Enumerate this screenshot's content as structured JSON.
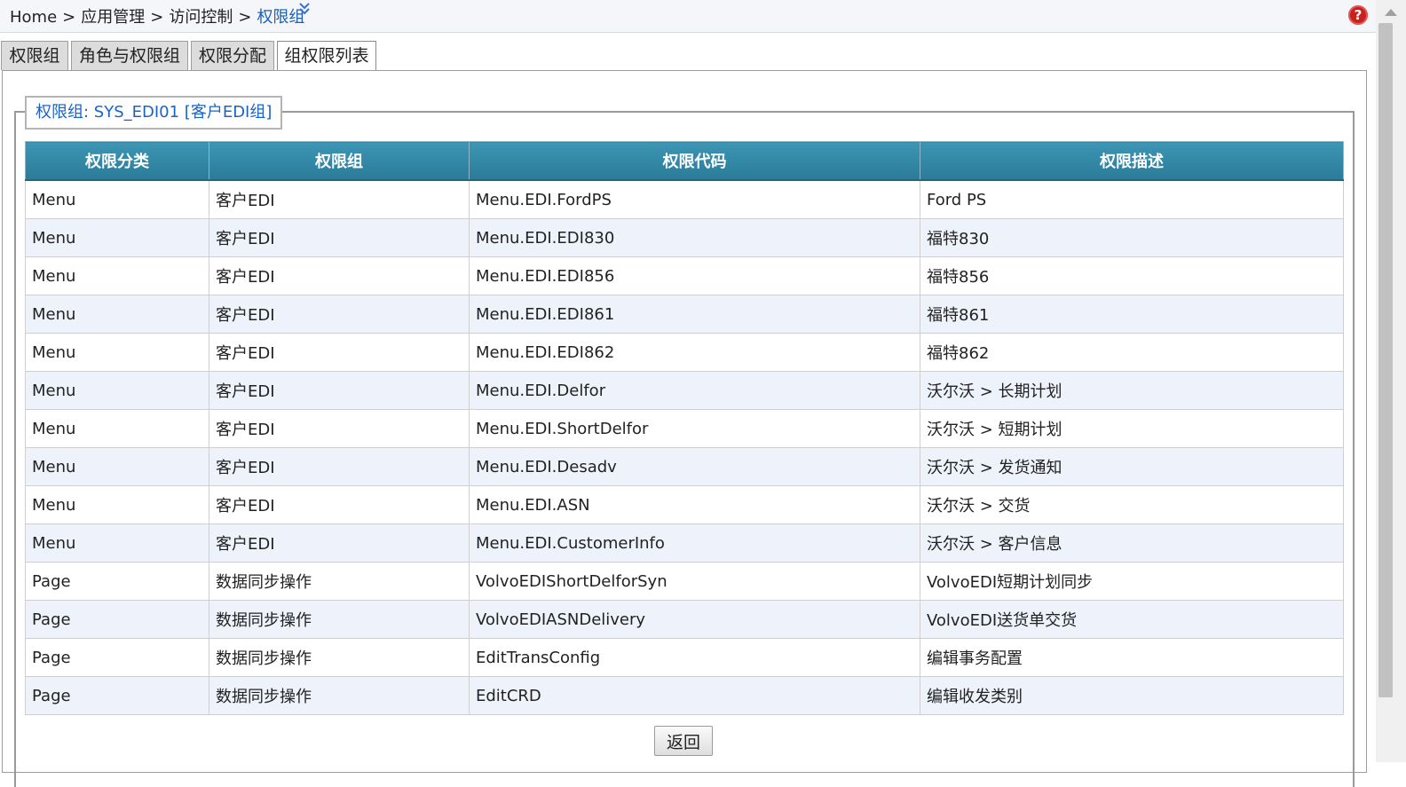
{
  "breadcrumb": {
    "items": [
      "Home",
      "应用管理",
      "访问控制"
    ],
    "current": "权限组",
    "separator": ">"
  },
  "tabs": [
    {
      "label": "权限组",
      "active": false
    },
    {
      "label": "角色与权限组",
      "active": false
    },
    {
      "label": "权限分配",
      "active": false
    },
    {
      "label": "组权限列表",
      "active": true
    }
  ],
  "group_legend": "权限组: SYS_EDI01 [客户EDI组]",
  "table": {
    "headers": [
      "权限分类",
      "权限组",
      "权限代码",
      "权限描述"
    ],
    "rows": [
      [
        "Menu",
        "客户EDI",
        "Menu.EDI.FordPS",
        "Ford PS"
      ],
      [
        "Menu",
        "客户EDI",
        "Menu.EDI.EDI830",
        "福特830"
      ],
      [
        "Menu",
        "客户EDI",
        "Menu.EDI.EDI856",
        "福特856"
      ],
      [
        "Menu",
        "客户EDI",
        "Menu.EDI.EDI861",
        "福特861"
      ],
      [
        "Menu",
        "客户EDI",
        "Menu.EDI.EDI862",
        "福特862"
      ],
      [
        "Menu",
        "客户EDI",
        "Menu.EDI.Delfor",
        "沃尔沃 > 长期计划"
      ],
      [
        "Menu",
        "客户EDI",
        "Menu.EDI.ShortDelfor",
        "沃尔沃 > 短期计划"
      ],
      [
        "Menu",
        "客户EDI",
        "Menu.EDI.Desadv",
        "沃尔沃 > 发货通知"
      ],
      [
        "Menu",
        "客户EDI",
        "Menu.EDI.ASN",
        "沃尔沃 > 交货"
      ],
      [
        "Menu",
        "客户EDI",
        "Menu.EDI.CustomerInfo",
        "沃尔沃 > 客户信息"
      ],
      [
        "Page",
        "数据同步操作",
        "VolvoEDIShortDelforSyn",
        "VolvoEDI短期计划同步"
      ],
      [
        "Page",
        "数据同步操作",
        "VolvoEDIASNDelivery",
        "VolvoEDI送货单交货"
      ],
      [
        "Page",
        "数据同步操作",
        "EditTransConfig",
        "编辑事务配置"
      ],
      [
        "Page",
        "数据同步操作",
        "EditCRD",
        "编辑收发类别"
      ]
    ]
  },
  "buttons": {
    "back_label": "返回"
  },
  "icons": {
    "help": "help-icon",
    "expand": "double-chevron-down-icon"
  },
  "colors": {
    "header_bg": "#2f86a5",
    "link_blue": "#1a63c7",
    "row_alt": "#eef2fb",
    "help_red": "#c8221f"
  }
}
